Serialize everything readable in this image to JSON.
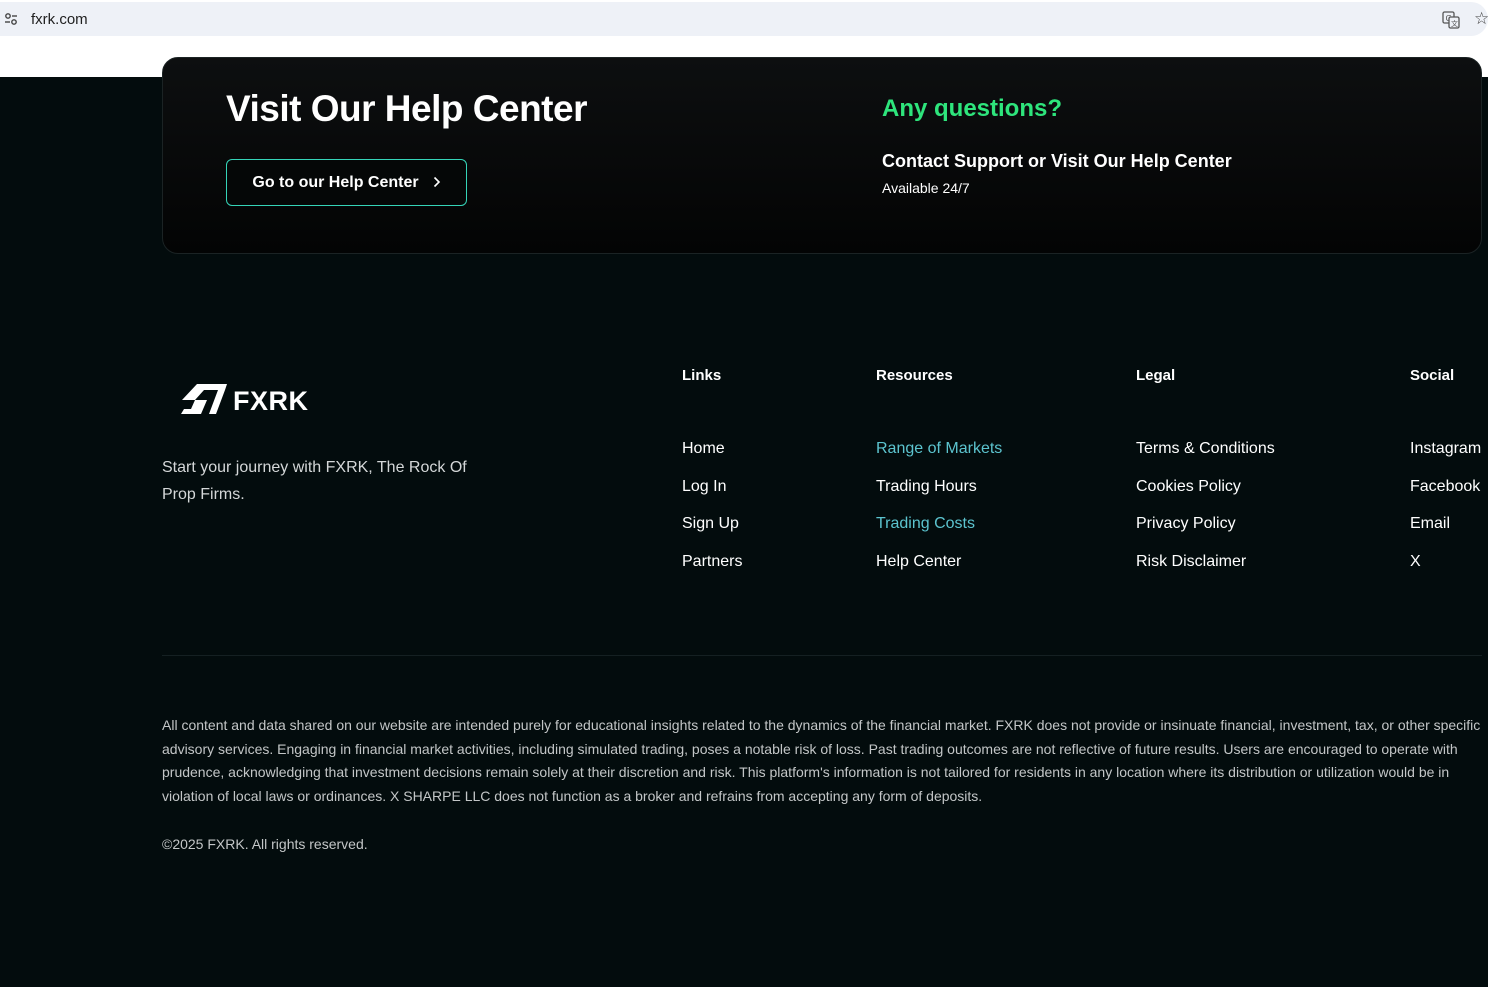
{
  "browser": {
    "url": "fxrk.com",
    "icons": {
      "site_info": "tune-icon",
      "translate": "translate-icon",
      "bookmark": "star-icon"
    }
  },
  "help": {
    "title": "Visit Our Help Center",
    "button_label": "Go to our Help Center",
    "button_icon": "chevron-right-icon",
    "questions_title": "Any questions?",
    "contact_text": "Contact Support or Visit Our Help Center",
    "availability": "Available 24/7"
  },
  "colors": {
    "accent_green": "#2ee57c",
    "accent_teal": "#5cc4cf",
    "button_border": "#35d4b8",
    "background": "#030c0d"
  },
  "footer": {
    "logo_text": "FXRK",
    "logo_icon": "fxrk-logo-icon",
    "tagline": "Start your journey with FXRK, The Rock Of Prop Firms.",
    "columns": [
      {
        "heading": "Links",
        "items": [
          "Home",
          "Log In",
          "Sign Up",
          "Partners"
        ]
      },
      {
        "heading": "Resources",
        "items": [
          "Range of Markets",
          "Trading Hours",
          "Trading Costs",
          "Help Center"
        ]
      },
      {
        "heading": "Legal",
        "items": [
          "Terms & Conditions",
          "Cookies Policy",
          "Privacy Policy",
          "Risk Disclaimer"
        ]
      },
      {
        "heading": "Social",
        "items": [
          "Instagram",
          "Facebook",
          "Email",
          "X"
        ]
      }
    ],
    "disclaimer": "All content and data shared on our website are intended purely for educational insights related to the dynamics of the financial market. FXRK does not provide or insinuate financial, investment, tax, or other specific advisory services. Engaging in financial market activities, including simulated trading, poses a notable risk of loss. Past trading outcomes are not reflective of future results. Users are encouraged to operate with prudence, acknowledging that investment decisions remain solely at their discretion and risk. This platform's information is not tailored for residents in any location where its distribution or utilization would be in violation of local laws or ordinances. X SHARPE LLC does not function as a broker and refrains from accepting any form of deposits.",
    "copyright": "©2025 FXRK. All rights reserved."
  }
}
